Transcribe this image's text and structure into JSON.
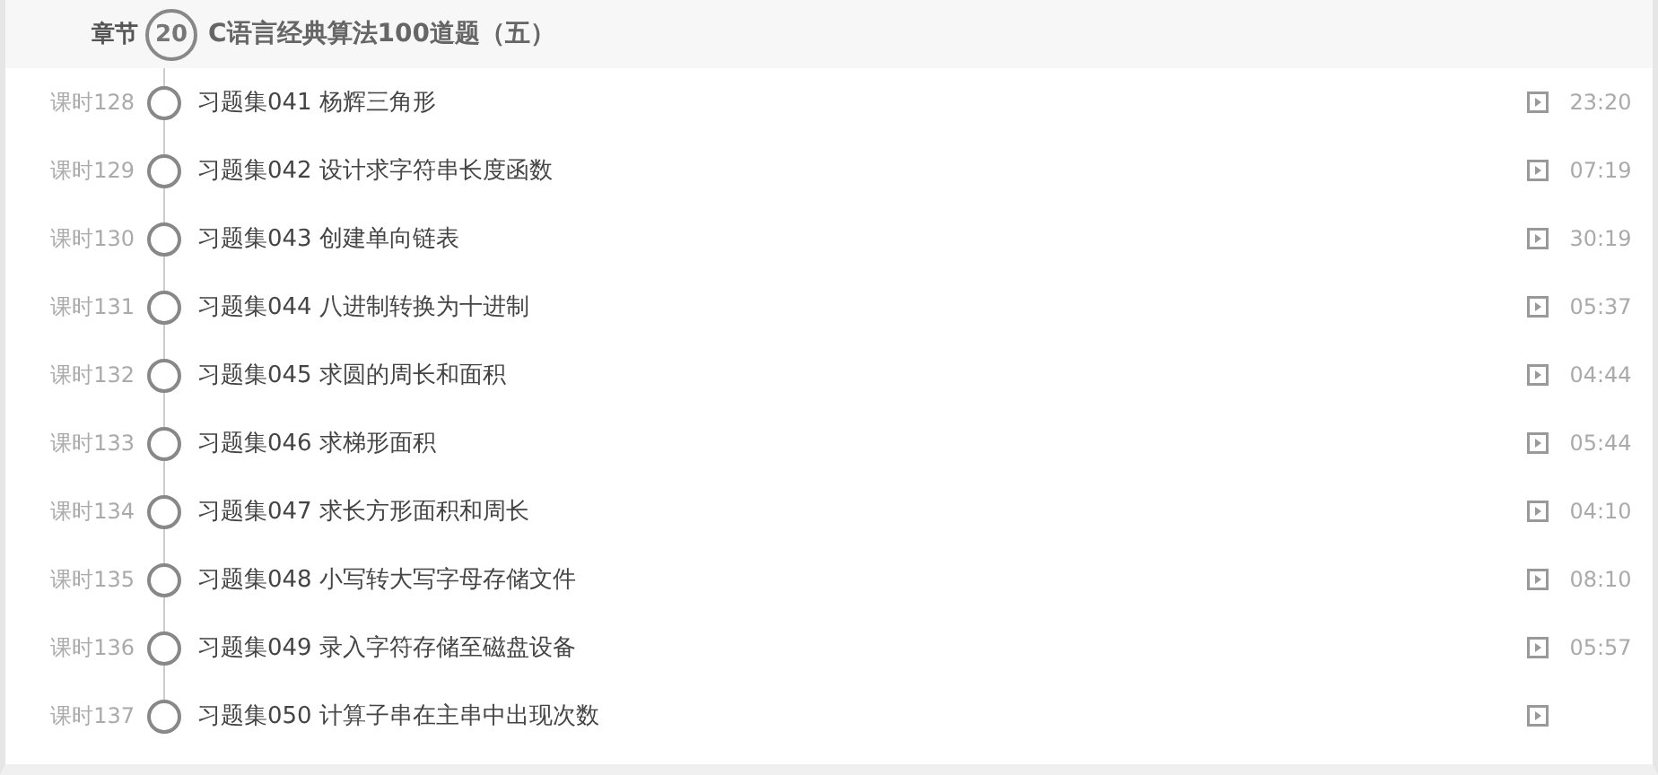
{
  "chapter": {
    "label": "章节",
    "number": "20",
    "title": "C语言经典算法100道题（五）"
  },
  "lessons": [
    {
      "label": "课时128",
      "title": "习题集041 杨辉三角形",
      "duration": "23:20"
    },
    {
      "label": "课时129",
      "title": "习题集042 设计求字符串长度函数",
      "duration": "07:19"
    },
    {
      "label": "课时130",
      "title": "习题集043 创建单向链表",
      "duration": "30:19"
    },
    {
      "label": "课时131",
      "title": "习题集044 八进制转换为十进制",
      "duration": "05:37"
    },
    {
      "label": "课时132",
      "title": "习题集045 求圆的周长和面积",
      "duration": "04:44"
    },
    {
      "label": "课时133",
      "title": "习题集046 求梯形面积",
      "duration": "05:44"
    },
    {
      "label": "课时134",
      "title": "习题集047 求长方形面积和周长",
      "duration": "04:10"
    },
    {
      "label": "课时135",
      "title": "习题集048 小写转大写字母存储文件",
      "duration": "08:10"
    },
    {
      "label": "课时136",
      "title": "习题集049 录入字符存储至磁盘设备",
      "duration": "05:57"
    },
    {
      "label": "课时137",
      "title": "习题集050 计算子串在主串中出现次数"
    }
  ]
}
